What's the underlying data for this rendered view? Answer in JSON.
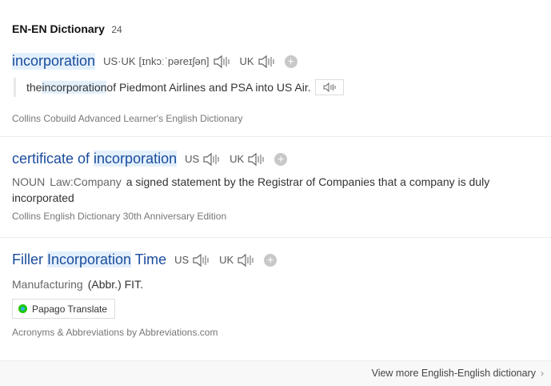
{
  "header": {
    "title": "EN-EN Dictionary",
    "count": "24"
  },
  "entries": [
    {
      "term_parts": [
        "incorporation"
      ],
      "term_highlight": "incorporation",
      "pron_prefix": "US·UK",
      "ipa": "[ɪnkɔːˈpəreɪʃən]",
      "uk_label": "UK",
      "example": {
        "pre": "the ",
        "highlight": "incorporation",
        "post": " of Piedmont Airlines and PSA into US Air."
      },
      "source": "Collins Cobuild Advanced Learner's English Dictionary"
    },
    {
      "term_pre": "certificate of ",
      "term_highlight": "incorporation",
      "us_label": "US",
      "uk_label": "UK",
      "pos": "NOUN",
      "domain_label": "Law:Company",
      "definition": "a signed statement by the Registrar of Companies that a company is duly incorporated",
      "source": "Collins English Dictionary 30th Anniversary Edition"
    },
    {
      "term_pre": "Filler ",
      "term_highlight": "Incorporation",
      "term_post": " Time",
      "us_label": "US",
      "uk_label": "UK",
      "domain_label": "Manufacturing",
      "definition": "(Abbr.) FIT.",
      "translate_button": "Papago Translate",
      "source": "Acronyms & Abbreviations by Abbreviations.com"
    }
  ],
  "footer": {
    "more_link": "View more English-English dictionary"
  },
  "icons": {
    "speaker": "speaker-icon",
    "plus": "plus-icon",
    "chevron": "chevron-right-icon",
    "papago": "papago-logo-icon"
  },
  "colors": {
    "term": "#1a4c9c",
    "highlight": "#e3f0fc",
    "papago_green": "#1ec800"
  }
}
